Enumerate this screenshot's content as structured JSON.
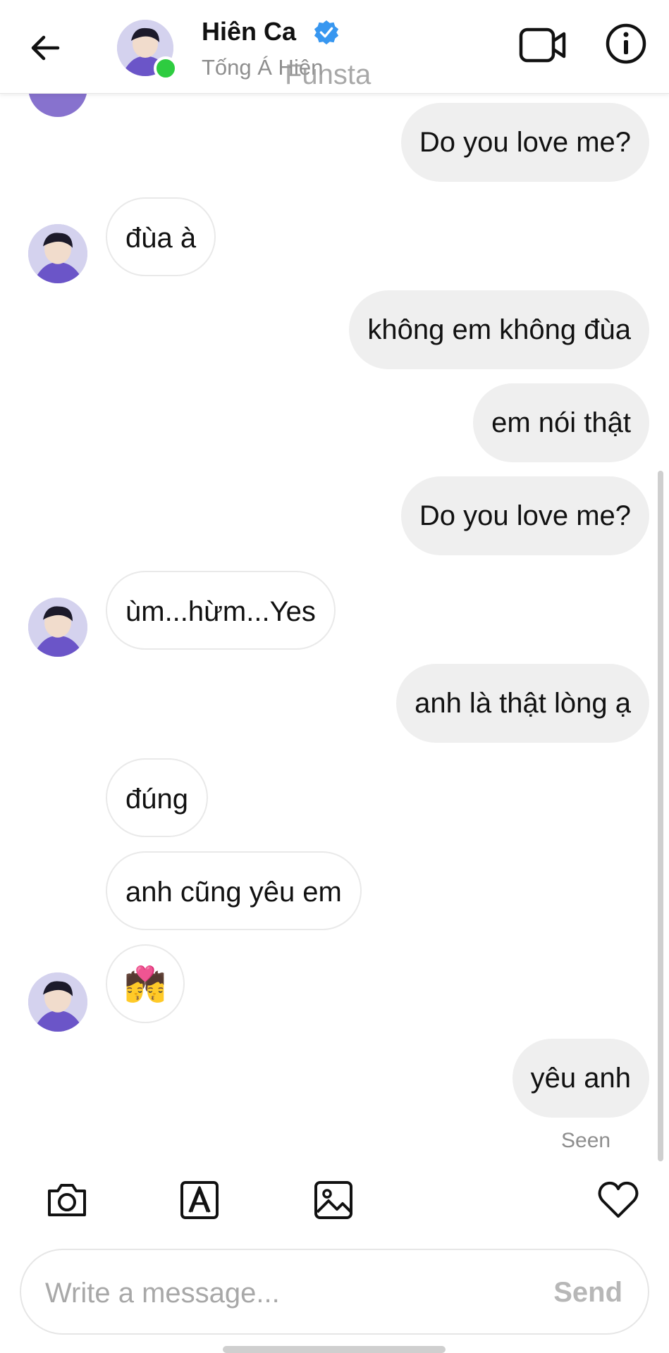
{
  "header": {
    "name": "Hiên Ca",
    "username": "Tống Á Hiên",
    "watermark": "Funsta",
    "icons": {
      "back": "back-arrow-icon",
      "verified": "verified-badge-icon",
      "video": "video-call-icon",
      "info": "info-icon"
    },
    "colors": {
      "verified": "#3897f0",
      "online": "#2ecc40"
    }
  },
  "messages": [
    {
      "from": "me",
      "text": "Do you love me?"
    },
    {
      "from": "them",
      "text": "đùa à"
    },
    {
      "from": "me",
      "text": "không em không đùa"
    },
    {
      "from": "me",
      "text": "em nói thật"
    },
    {
      "from": "me",
      "text": "Do you love me?"
    },
    {
      "from": "them",
      "text": "ùm...hừm...Yes"
    },
    {
      "from": "me",
      "text": "anh là thật lòng ạ"
    },
    {
      "from": "them",
      "text": "đúng"
    },
    {
      "from": "them",
      "text": "anh cũng yêu em"
    },
    {
      "from": "them",
      "text": "💏"
    },
    {
      "from": "me",
      "text": "yêu anh"
    }
  ],
  "status": {
    "seen": "Seen"
  },
  "toolbar": {
    "icons": [
      "camera-icon",
      "sticker-icon",
      "gallery-icon",
      "heart-icon"
    ]
  },
  "composer": {
    "placeholder": "Write a message...",
    "send_label": "Send"
  }
}
